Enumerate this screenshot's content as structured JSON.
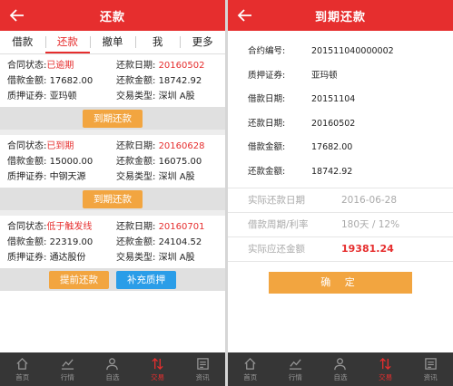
{
  "left": {
    "header": {
      "title": "还款"
    },
    "tabs": [
      {
        "label": "借款"
      },
      {
        "label": "还款"
      },
      {
        "label": "撤单"
      },
      {
        "label": "我"
      },
      {
        "label": "更多"
      }
    ],
    "cards": [
      {
        "status_label": "合同状态:",
        "status_value": "已逾期",
        "repay_date_label": "还款日期:",
        "repay_date_value": "20160502",
        "loan_amount_label": "借款金额:",
        "loan_amount_value": "17682.00",
        "repay_amount_label": "还款金额:",
        "repay_amount_value": "18742.92",
        "security_label": "质押证券:",
        "security_value": "亚玛顿",
        "market_label": "交易类型:",
        "market_value": "深圳 A股",
        "buttons": [
          "到期还款"
        ]
      },
      {
        "status_label": "合同状态:",
        "status_value": "已到期",
        "repay_date_label": "还款日期:",
        "repay_date_value": "20160628",
        "loan_amount_label": "借款金额:",
        "loan_amount_value": "15000.00",
        "repay_amount_label": "还款金额:",
        "repay_amount_value": "16075.00",
        "security_label": "质押证券:",
        "security_value": "中钢天源",
        "market_label": "交易类型:",
        "market_value": "深圳 A股",
        "buttons": [
          "到期还款"
        ]
      },
      {
        "status_label": "合同状态:",
        "status_value": "低于触发线",
        "repay_date_label": "还款日期:",
        "repay_date_value": "20160701",
        "loan_amount_label": "借款金额:",
        "loan_amount_value": "22319.00",
        "repay_amount_label": "还款金额:",
        "repay_amount_value": "24104.52",
        "security_label": "质押证券:",
        "security_value": "通达股份",
        "market_label": "交易类型:",
        "market_value": "深圳 A股",
        "buttons": [
          "提前还款",
          "补充质押"
        ]
      }
    ]
  },
  "right": {
    "header": {
      "title": "到期还款"
    },
    "details": [
      {
        "label": "合约编号:",
        "value": "201511040000002"
      },
      {
        "label": "质押证券:",
        "value": "亚玛顿"
      },
      {
        "label": "借款日期:",
        "value": "20151104"
      },
      {
        "label": "还款日期:",
        "value": "20160502"
      },
      {
        "label": "借款金额:",
        "value": "17682.00"
      },
      {
        "label": "还款金额:",
        "value": "18742.92"
      }
    ],
    "actual_date": {
      "label": "实际还款日期",
      "value": "2016-06-28"
    },
    "period_rate": {
      "label": "借款周期/利率",
      "value": "180天 / 12%"
    },
    "actual_amount": {
      "label": "实际应还金额",
      "value": "19381.24"
    },
    "confirm_label": "确 定"
  },
  "nav": [
    {
      "label": "首页",
      "icon": "home-icon"
    },
    {
      "label": "行情",
      "icon": "chart-icon"
    },
    {
      "label": "自选",
      "icon": "user-icon"
    },
    {
      "label": "交易",
      "icon": "trade-icon"
    },
    {
      "label": "资讯",
      "icon": "news-icon"
    }
  ],
  "colors": {
    "brand": "#e62e2e",
    "orange": "#f2a540",
    "blue": "#2a9de8",
    "nav_bg": "#363636"
  }
}
